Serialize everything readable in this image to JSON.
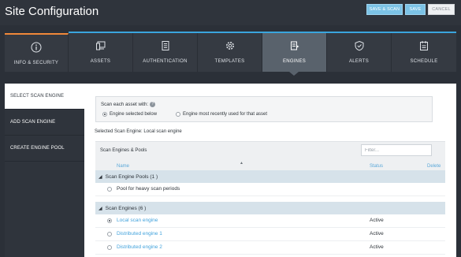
{
  "header": {
    "title": "Site Configuration",
    "buttons": {
      "save_scan": "SAVE & SCAN",
      "save": "SAVE",
      "cancel": "CANCEL"
    }
  },
  "tabs": [
    {
      "label": "INFO & SECURITY",
      "icon": "info-icon"
    },
    {
      "label": "ASSETS",
      "icon": "assets-icon"
    },
    {
      "label": "AUTHENTICATION",
      "icon": "authentication-icon"
    },
    {
      "label": "TEMPLATES",
      "icon": "gear-icon"
    },
    {
      "label": "ENGINES",
      "icon": "engine-icon",
      "active": true
    },
    {
      "label": "ALERTS",
      "icon": "shield-check-icon"
    },
    {
      "label": "SCHEDULE",
      "icon": "calendar-icon"
    }
  ],
  "sidebar": {
    "items": [
      {
        "label": "SELECT SCAN ENGINE",
        "active": true
      },
      {
        "label": "ADD SCAN ENGINE"
      },
      {
        "label": "CREATE ENGINE POOL"
      }
    ]
  },
  "scan_options": {
    "question": "Scan each asset with:",
    "option_selected_below": "Engine selected below",
    "option_most_recent": "Engine most recently used for that asset",
    "selected_option": "Engine selected below"
  },
  "selected_engine": {
    "label": "Selected Scan Engine:",
    "value": "Local scan engine"
  },
  "table": {
    "title": "Scan Engines & Pools",
    "filter_placeholder": "Filter...",
    "columns": {
      "name": "Name",
      "status": "Status",
      "delete": "Delete"
    },
    "groups": [
      {
        "label": "Scan Engine Pools (1 )",
        "rows": [
          {
            "name": "Pool for heavy scan periods",
            "status": "",
            "link": false,
            "selected": false
          }
        ]
      },
      {
        "label": "Scan Engines (6 )",
        "rows": [
          {
            "name": "Local scan engine",
            "status": "Active",
            "link": true,
            "selected": true
          },
          {
            "name": "Distributed engine 1",
            "status": "Active",
            "link": true,
            "selected": false
          },
          {
            "name": "Distributed engine 2",
            "status": "Active",
            "link": true,
            "selected": false
          }
        ]
      }
    ]
  },
  "colors": {
    "accent_orange": "#f0883a",
    "accent_blue": "#3aa5dd",
    "link_blue": "#43a3dc",
    "dark_bg": "#2b3038"
  }
}
